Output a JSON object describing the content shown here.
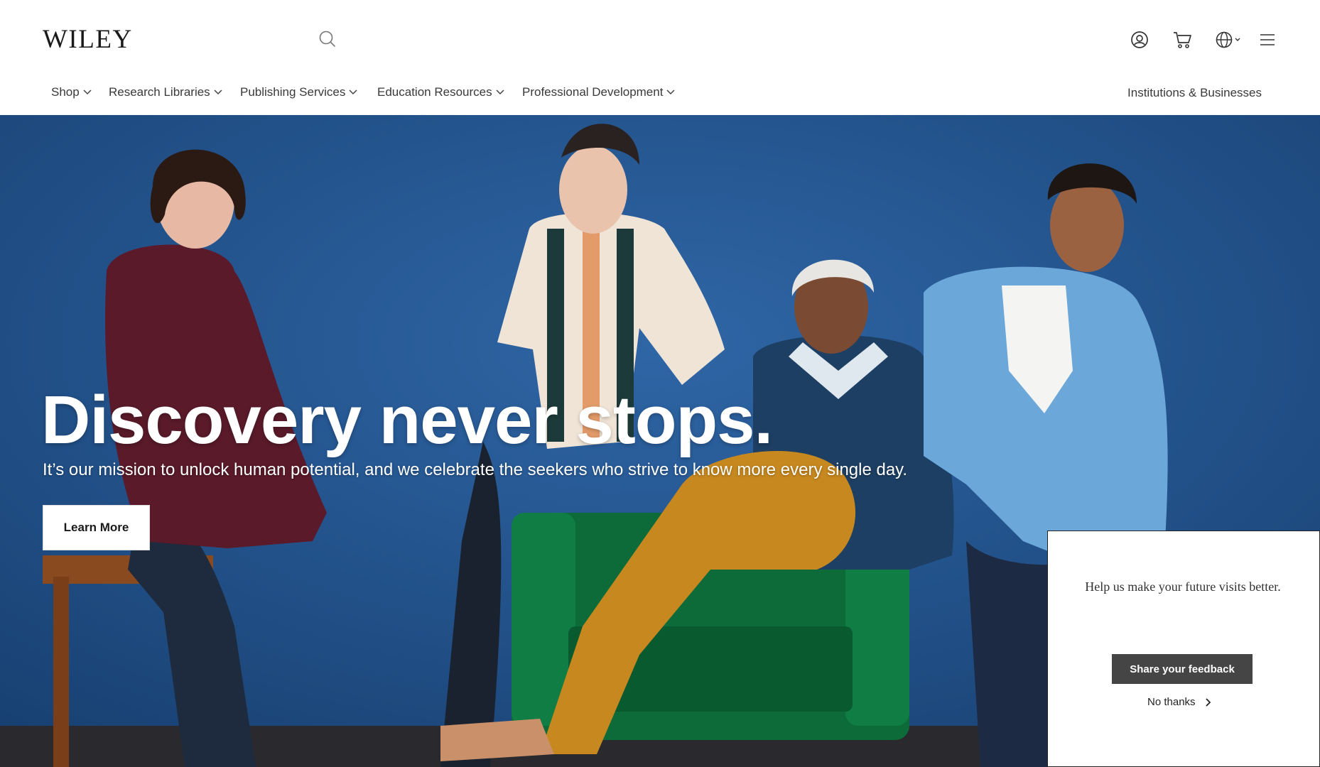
{
  "header": {
    "logo": "WILEY",
    "search": {
      "value": "",
      "placeholder": ""
    },
    "icons": [
      "search-icon",
      "account-icon",
      "cart-icon",
      "globe-icon",
      "menu-icon"
    ]
  },
  "nav": {
    "items": [
      {
        "label": "Shop"
      },
      {
        "label": "Research Libraries"
      },
      {
        "label": "Publishing Services"
      },
      {
        "label": "Education Resources"
      },
      {
        "label": "Professional Development"
      }
    ],
    "right_link": "Institutions & Businesses"
  },
  "hero": {
    "title": "Discovery never stops.",
    "subtitle": "It’s our mission to unlock human potential, and we celebrate the seekers who strive to know more every single day.",
    "cta": "Learn More",
    "background_color": "#1f4f86"
  },
  "feedback": {
    "message": "Help us make your future visits better.",
    "primary_button": "Share your feedback",
    "secondary_link": "No thanks"
  }
}
